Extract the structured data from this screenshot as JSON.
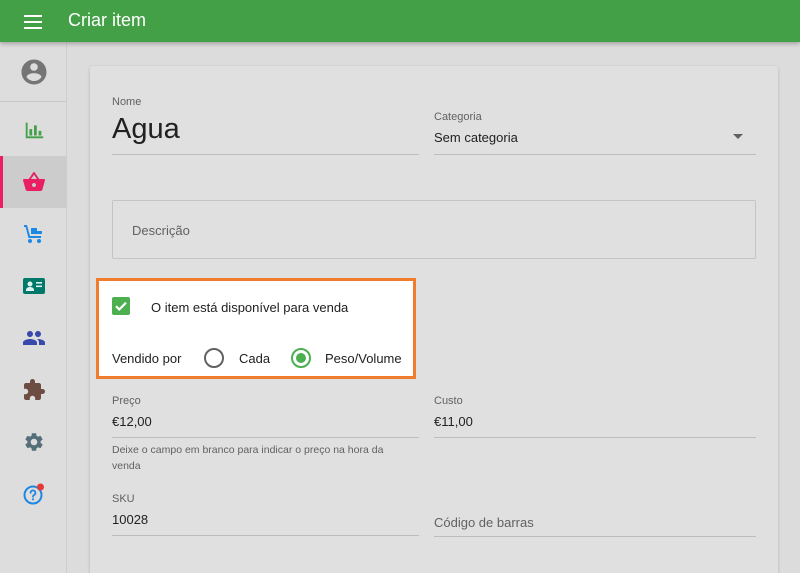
{
  "appbar": {
    "title": "Criar item",
    "menu_icon": "menu-icon"
  },
  "sidebar": {
    "items": [
      {
        "name": "account",
        "icon": "account-circle-icon",
        "color": "#757575",
        "active": false
      },
      {
        "name": "reports",
        "icon": "bar-chart-icon",
        "color": "#43a047",
        "active": false
      },
      {
        "name": "items",
        "icon": "shopping-basket-icon",
        "color": "#e91e63",
        "active": true
      },
      {
        "name": "inventory",
        "icon": "dolly-icon",
        "color": "#1e88e5",
        "active": false
      },
      {
        "name": "employees",
        "icon": "badge-icon",
        "color": "#00796b",
        "active": false
      },
      {
        "name": "customers",
        "icon": "people-icon",
        "color": "#3949ab",
        "active": false
      },
      {
        "name": "integrations",
        "icon": "puzzle-icon",
        "color": "#6d4c41",
        "active": false
      },
      {
        "name": "settings",
        "icon": "gear-icon",
        "color": "#546e7a",
        "active": false
      },
      {
        "name": "help",
        "icon": "help-icon",
        "color": "#1e88e5",
        "active": false,
        "badge_color": "#e53935"
      }
    ]
  },
  "form": {
    "name": {
      "label": "Nome",
      "value": "Agua"
    },
    "category": {
      "label": "Categoria",
      "value": "Sem categoria"
    },
    "description": {
      "placeholder": "Descrição"
    },
    "available": {
      "label": "O item está disponível para venda",
      "checked": true
    },
    "sold_by": {
      "label": "Vendido por",
      "options": [
        "Cada",
        "Peso/Volume"
      ],
      "selected": "Peso/Volume"
    },
    "price": {
      "label": "Preço",
      "value": "€12,00",
      "hint": "Deixe o campo em branco para indicar o preço na hora da venda"
    },
    "cost": {
      "label": "Custo",
      "value": "€11,00"
    },
    "sku": {
      "label": "SKU",
      "value": "10028"
    },
    "barcode": {
      "placeholder": "Código de barras"
    }
  },
  "colors": {
    "primary": "#43a047",
    "accent": "#e91e63",
    "highlight_border": "#f07d2d",
    "checkbox": "#4caf50"
  }
}
